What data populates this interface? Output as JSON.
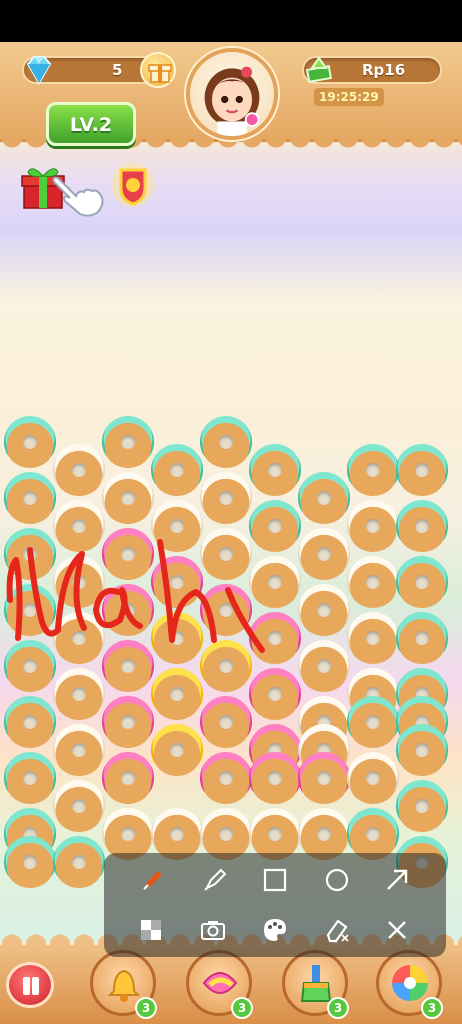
{
  "hud": {
    "gems": "5",
    "money": "Rp16",
    "timer": "19:25:29",
    "level": "LV.2"
  },
  "boosters": [
    {
      "name": "bell",
      "count": "3"
    },
    {
      "name": "candy",
      "count": "3"
    },
    {
      "name": "brush",
      "count": "3"
    },
    {
      "name": "rainbow-ball",
      "count": "3"
    }
  ],
  "annotation": {
    "scribble_text": "Nah",
    "scribble_color": "#e5261a"
  },
  "draw_tools": [
    "pen",
    "marker",
    "rectangle",
    "circle",
    "arrow",
    "mosaic",
    "camera",
    "palette",
    "eraser",
    "close"
  ],
  "colors": {
    "mint": "#7fe6cf",
    "cream": "#fffaf0",
    "pink": "#ff7fc3",
    "yellow": "#ffe14a",
    "hud_brown": "#b87637",
    "level_green": "#3fa22a"
  },
  "board": {
    "rows": [
      [
        "mint",
        "",
        "mint",
        "",
        "mint",
        "",
        "",
        ""
      ],
      [
        "",
        "cream",
        "",
        "mint",
        "",
        "mint",
        "",
        "mint",
        "mint"
      ],
      [
        "mint",
        "",
        "cream",
        "",
        "cream",
        "",
        "mint",
        "",
        ""
      ],
      [
        "",
        "cream",
        "",
        "cream",
        "",
        "mint",
        "",
        "cream",
        "mint"
      ],
      [
        "mint",
        "",
        "pink",
        "",
        "cream",
        "",
        "cream",
        "",
        ""
      ],
      [
        "",
        "cream",
        "",
        "pink",
        "",
        "cream",
        "",
        "cream",
        "mint"
      ],
      [
        "mint",
        "",
        "pink",
        "",
        "pink",
        "",
        "cream",
        "",
        ""
      ],
      [
        "",
        "cream",
        "",
        "yellow",
        "",
        "pink",
        "",
        "cream",
        "mint"
      ],
      [
        "mint",
        "",
        "pink",
        "",
        "yellow",
        "",
        "cream",
        "",
        ""
      ],
      [
        "",
        "cream",
        "",
        "yellow",
        "",
        "pink",
        "",
        "cream",
        "mint"
      ],
      [
        "mint",
        "",
        "pink",
        "",
        "pink",
        "",
        "cream",
        "mint",
        "mint"
      ],
      [
        "",
        "cream",
        "",
        "yellow",
        "",
        "pink",
        "cream",
        "",
        "mint"
      ],
      [
        "mint",
        "",
        "pink",
        "",
        "pink",
        "pink",
        "pink",
        "cream",
        ""
      ],
      [
        "",
        "cream",
        "",
        "",
        "",
        "",
        "",
        "",
        "mint"
      ],
      [
        "mint",
        "",
        "cream",
        "cream",
        "cream",
        "cream",
        "cream",
        "mint",
        ""
      ],
      [
        "mint",
        "mint",
        "",
        "",
        "",
        "",
        "",
        "",
        "mint"
      ]
    ]
  }
}
